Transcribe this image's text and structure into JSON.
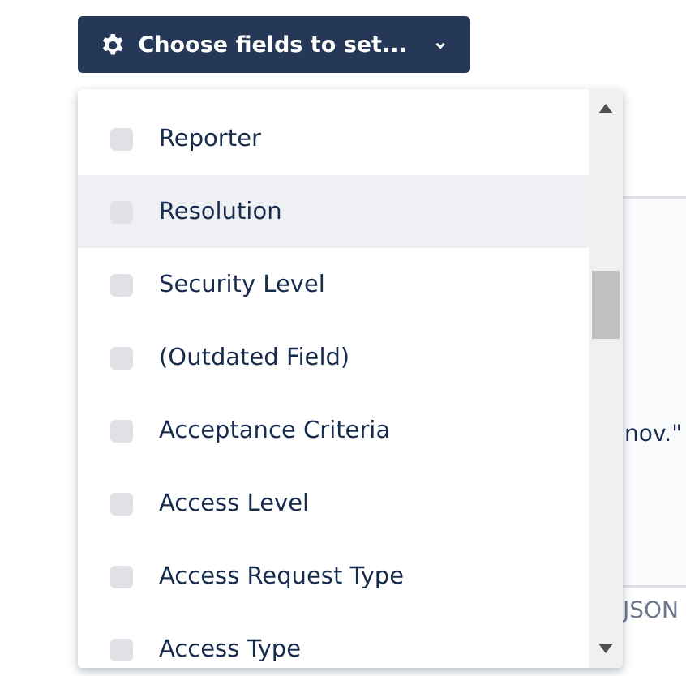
{
  "button": {
    "label": "Choose fields to set..."
  },
  "background": {
    "quote_end": "nov.\"",
    "footer_fragment": "JSON"
  },
  "options": [
    {
      "label": "Reporter",
      "checked": false,
      "highlighted": false
    },
    {
      "label": "Resolution",
      "checked": false,
      "highlighted": true
    },
    {
      "label": "Security Level",
      "checked": false,
      "highlighted": false
    },
    {
      "label": "(Outdated Field)",
      "checked": false,
      "highlighted": false
    },
    {
      "label": "Acceptance Criteria",
      "checked": false,
      "highlighted": false
    },
    {
      "label": "Access Level",
      "checked": false,
      "highlighted": false
    },
    {
      "label": "Access Request Type",
      "checked": false,
      "highlighted": false
    },
    {
      "label": "Access Type",
      "checked": false,
      "highlighted": false
    }
  ]
}
